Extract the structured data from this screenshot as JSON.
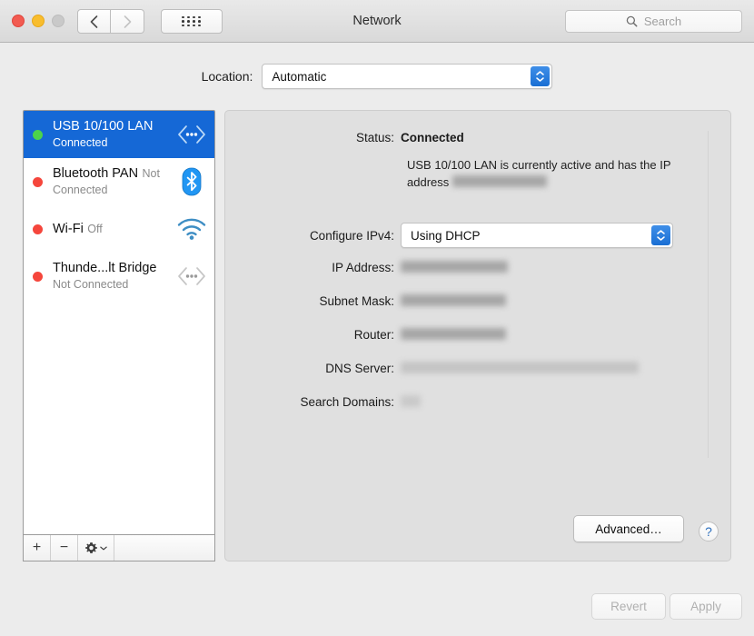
{
  "window": {
    "title": "Network",
    "traffic_lights": [
      "close",
      "minimize",
      "zoom"
    ],
    "back_label": "Back",
    "forward_label": "Forward",
    "showall_label": "Show All"
  },
  "search": {
    "placeholder": "Search",
    "value": ""
  },
  "location": {
    "label": "Location:",
    "selected": "Automatic"
  },
  "sidebar": {
    "services": [
      {
        "name": "USB 10/100 LAN",
        "status": "Connected",
        "dot": "green",
        "icon": "ethernet-icon",
        "selected": true
      },
      {
        "name": "Bluetooth PAN",
        "status": "Not Connected",
        "dot": "red",
        "icon": "bluetooth-icon",
        "selected": false
      },
      {
        "name": "Wi-Fi",
        "status": "Off",
        "dot": "red",
        "icon": "wifi-icon",
        "selected": false
      },
      {
        "name": "Thunde...lt Bridge",
        "status": "Not Connected",
        "dot": "red",
        "icon": "ethernet-icon",
        "selected": false
      }
    ],
    "footer": {
      "add_label": "+",
      "remove_label": "−",
      "action_label": "⚙"
    }
  },
  "detail": {
    "status_label": "Status:",
    "status_value": "Connected",
    "status_description_prefix": "USB 10/100 LAN is currently active and has the IP address ",
    "status_description_redacted": true,
    "configure_label": "Configure IPv4:",
    "configure_value": "Using DHCP",
    "fields": [
      {
        "label": "IP Address:",
        "value": "",
        "redacted": true,
        "redact_width": 118,
        "redact_style": "dark"
      },
      {
        "label": "Subnet Mask:",
        "value": "",
        "redacted": true,
        "redact_width": 116,
        "redact_style": "dark"
      },
      {
        "label": "Router:",
        "value": "",
        "redacted": true,
        "redact_width": 116,
        "redact_style": "dark"
      },
      {
        "label": "DNS Server:",
        "value": "",
        "redacted": true,
        "redact_width": 262,
        "redact_style": "light"
      },
      {
        "label": "Search Domains:",
        "value": "",
        "redacted": true,
        "redact_width": 22,
        "redact_style": "tiny"
      }
    ],
    "advanced_label": "Advanced…",
    "help_label": "?"
  },
  "footer": {
    "revert_label": "Revert",
    "revert_enabled": false,
    "apply_label": "Apply",
    "apply_enabled": false
  },
  "colors": {
    "accent_blue": "#1568d6",
    "connected_green": "#4cd34c",
    "disconnected_red": "#f5463c",
    "panel_grey": "#e0e0e0"
  }
}
